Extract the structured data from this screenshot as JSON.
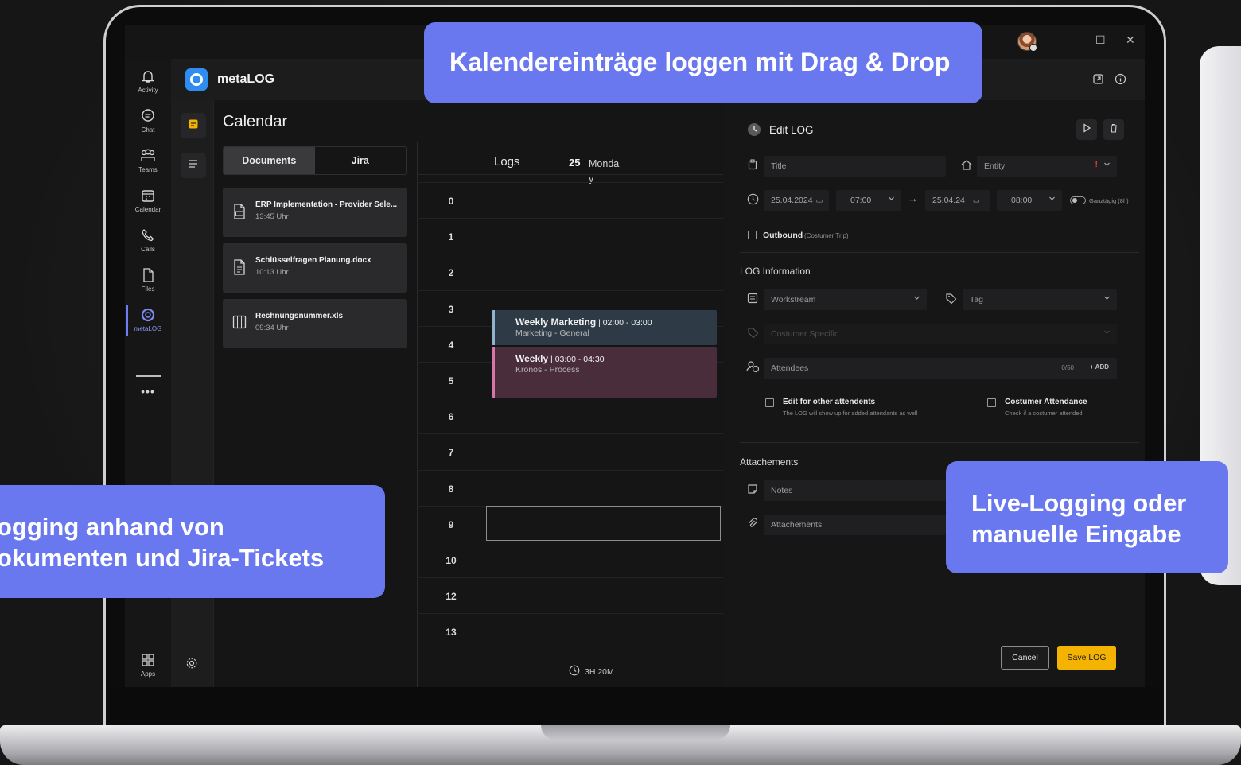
{
  "callouts": {
    "top": "Kalendereinträge loggen mit Drag & Drop",
    "left_line1": "ogging anhand von",
    "left_line2": "okumenten und Jira-Tickets",
    "right_line1": "Live-Logging oder",
    "right_line2": "manuelle Eingabe"
  },
  "app": {
    "name": "metaLOG"
  },
  "rail": {
    "items": [
      {
        "label": "Activity",
        "icon": "bell-icon"
      },
      {
        "label": "Chat",
        "icon": "chat-icon"
      },
      {
        "label": "Teams",
        "icon": "teams-icon"
      },
      {
        "label": "Calendar",
        "icon": "calendar-icon"
      },
      {
        "label": "Calls",
        "icon": "phone-icon"
      },
      {
        "label": "Files",
        "icon": "file-icon"
      },
      {
        "label": "metaLOG",
        "icon": "metalog-icon"
      }
    ],
    "more": "•••",
    "apps_label": "Apps"
  },
  "calendar": {
    "title": "Calendar",
    "tabs": [
      "Documents",
      "Jira"
    ],
    "documents": [
      {
        "title": "ERP Implementation - Provider Sele...",
        "time": "13:45 Uhr",
        "icon": "pdf-icon"
      },
      {
        "title": "Schlüsselfragen Planung.docx",
        "time": "10:13 Uhr",
        "icon": "doc-icon"
      },
      {
        "title": "Rechnungsnummer.xls",
        "time": "09:34 Uhr",
        "icon": "sheet-icon"
      }
    ]
  },
  "schedule": {
    "header": "Logs",
    "day_number": "25",
    "day_name": "Monday",
    "hours": [
      "0",
      "1",
      "2",
      "3",
      "4",
      "5",
      "6",
      "7",
      "8",
      "9",
      "10",
      "12",
      "13"
    ],
    "events": [
      {
        "title": "Weekly Marketing",
        "time": " | 02:00 - 03:00",
        "subtitle": "Marketing - General",
        "color": "#2e3b46",
        "accent": "#8fb3cf"
      },
      {
        "title": "Weekly",
        "time": " | 03:00 - 04:30",
        "subtitle": "Kronos - Process",
        "color": "#4a2d3a",
        "accent": "#d676a8"
      }
    ],
    "total": "3H 20M"
  },
  "edit_log": {
    "title": "Edit LOG",
    "title_placeholder": "Title",
    "entity_placeholder": "Entity",
    "start_date": "25.04.2024",
    "start_time": "07:00",
    "end_date": "25.04.24",
    "end_time": "08:00",
    "allday_label": "Ganztägig (8h)",
    "outbound_label": "Outbound",
    "outbound_hint": "(Costumer Trip)",
    "log_info_header": "LOG Information",
    "workstream_placeholder": "Workstream",
    "tag_placeholder": "Tag",
    "customer_specific_placeholder": "Costumer Specific",
    "attendees_label": "Attendees",
    "attendees_count": "0/50",
    "add_label": "+ ADD",
    "edit_other_label": "Edit for other attendents",
    "edit_other_hint": "The LOG will show up for added attendants as well",
    "customer_att_label": "Costumer Attendance",
    "customer_att_hint": "Check if a costumer attended",
    "attachments_header": "Attachements",
    "notes_placeholder": "Notes",
    "attachments_placeholder": "Attachements",
    "cancel_label": "Cancel",
    "save_label": "Save LOG"
  },
  "colors": {
    "accent": "#6a78ef",
    "save": "#f5b301",
    "required": "#e23b3b"
  }
}
